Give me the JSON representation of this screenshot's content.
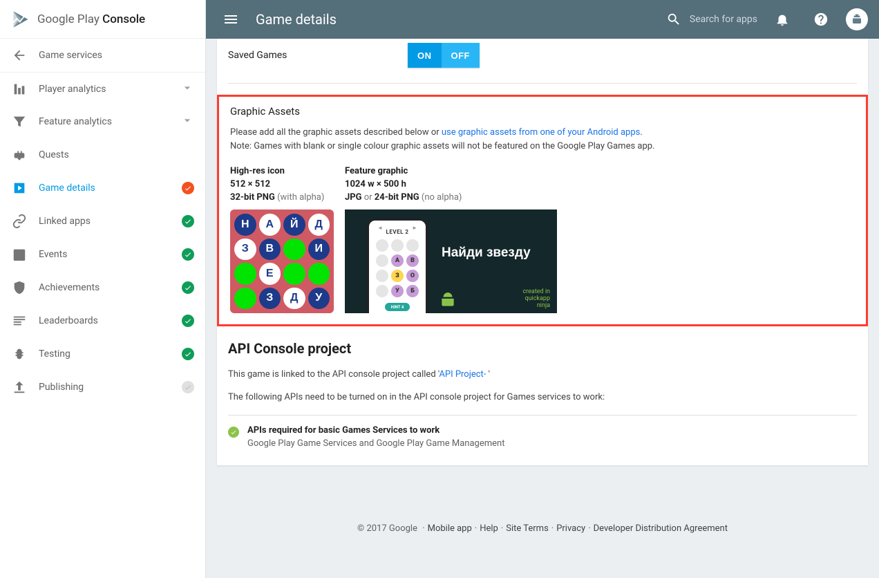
{
  "brand": {
    "name_a": "Google Play",
    "name_b": "Console"
  },
  "appbar": {
    "title": "Game details",
    "search_placeholder": "Search for apps"
  },
  "sidebar": [
    {
      "id": "game-services",
      "label": "Game services",
      "icon": "back",
      "status": null
    },
    {
      "id": "player-analytics",
      "label": "Player analytics",
      "icon": "bar",
      "status": null,
      "expandable": true
    },
    {
      "id": "feature-analytics",
      "label": "Feature analytics",
      "icon": "funnel",
      "status": null,
      "expandable": true
    },
    {
      "id": "quests",
      "label": "Quests",
      "icon": "gamepad",
      "status": null
    },
    {
      "id": "game-details",
      "label": "Game details",
      "icon": "play-badge",
      "status": "orange",
      "active": true
    },
    {
      "id": "linked-apps",
      "label": "Linked apps",
      "icon": "link",
      "status": "green"
    },
    {
      "id": "events",
      "label": "Events",
      "icon": "calendar",
      "status": "green"
    },
    {
      "id": "achievements",
      "label": "Achievements",
      "icon": "shield",
      "status": "green"
    },
    {
      "id": "leaderboards",
      "label": "Leaderboards",
      "icon": "leaderboard",
      "status": "green"
    },
    {
      "id": "testing",
      "label": "Testing",
      "icon": "bug",
      "status": "green"
    },
    {
      "id": "publishing",
      "label": "Publishing",
      "icon": "publish",
      "status": "gray"
    }
  ],
  "saved_games": {
    "label": "Saved Games",
    "on": "ON",
    "off": "OFF"
  },
  "graphic_assets": {
    "title": "Graphic Assets",
    "help_1": "Please add all the graphic assets described below or ",
    "help_link": "use graphic assets from one of your Android apps",
    "help_2": ".",
    "note": "Note: Games with blank or single colour graphic assets will not be featured on the Google Play Games app.",
    "icon_spec": {
      "title": "High-res icon",
      "dim": "512 × 512",
      "fmt_b": "32-bit PNG",
      "fmt_m": " (with alpha)"
    },
    "feature_spec": {
      "title": "Feature graphic",
      "dim": "1024 w × 500 h",
      "fmt_b1": "JPG",
      "fmt_m1": " or ",
      "fmt_b2": "24-bit PNG",
      "fmt_m2": " (no alpha)"
    },
    "icon_letters": [
      "Н",
      "А",
      "Й",
      "Д",
      "З",
      "В",
      "",
      "И",
      "",
      "Е",
      "",
      "",
      "",
      "З",
      "Д",
      "У"
    ],
    "feature_title": "Найди звезду",
    "phone_level": "LEVEL 2",
    "phone_hint": "HINT  4",
    "ninja_credit": "created in\nquickapp\nninja"
  },
  "api": {
    "title": "API Console project",
    "line1_a": "This game is linked to the API console project called '",
    "line1_link": "API Project-",
    "line1_b": " '",
    "line2": "The following APIs need to be turned on in the API console project for Games services to work:",
    "req_title": "APIs required for basic Games Services to work",
    "req_sub": "Google Play Game Services and Google Play Game Management"
  },
  "footer": {
    "copyright": "© 2017 Google",
    "links": [
      "Mobile app",
      "Help",
      "Site Terms",
      "Privacy",
      "Developer Distribution Agreement"
    ]
  }
}
